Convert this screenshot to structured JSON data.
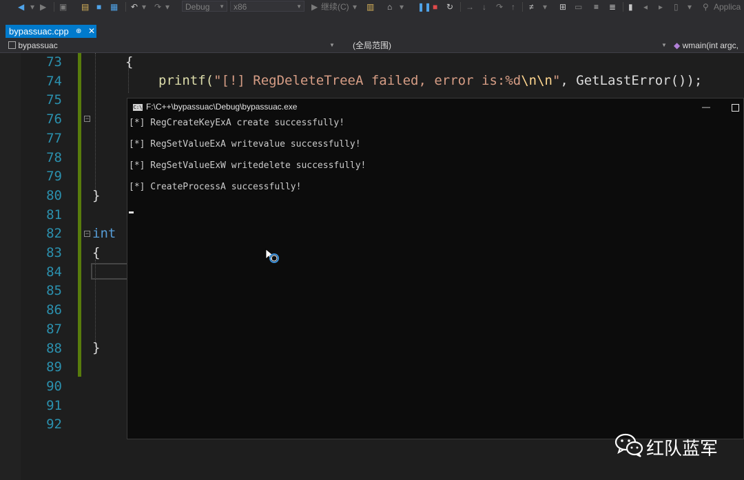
{
  "toolbar": {
    "config": "Debug",
    "platform": "x86",
    "continue_label": "继续(C)",
    "app_label": "Applica"
  },
  "tabs": [
    {
      "label": "bypassuac.cpp"
    }
  ],
  "navbar": {
    "project": "bypassuac",
    "scope": "(全局范围)",
    "member": "wmain(int argc,"
  },
  "editor": {
    "line_numbers": [
      "73",
      "74",
      "75",
      "76",
      "77",
      "78",
      "79",
      "80",
      "81",
      "82",
      "83",
      "84",
      "85",
      "86",
      "87",
      "88",
      "89",
      "90",
      "91",
      "92"
    ],
    "code": {
      "l73": "{",
      "l74_fn": "printf(",
      "l74_str1": "\"[!] RegDeleteTreeA failed, error is:%d",
      "l74_esc": "\\n\\n",
      "l74_str2": "\"",
      "l74_rest": ", GetLastError());",
      "l80": "}",
      "l82_kw": "int",
      "l83": "{",
      "l88": "}"
    }
  },
  "console": {
    "title": "F:\\C++\\bypassuac\\Debug\\bypassuac.exe",
    "icon_text": "C:\\",
    "lines": [
      "[*] RegCreateKeyExA create successfully!",
      "[*] RegSetValueExA writevalue successfully!",
      "[*] RegSetValueExW writedelete successfully!",
      "[*] CreateProcessA successfully!"
    ]
  },
  "watermark": {
    "text": "红队蓝军"
  },
  "colors": {
    "accent": "#007acc",
    "line_numbers": "#2b91af",
    "keyword": "#569cd6",
    "string": "#d69d85",
    "change_bar": "#587c0c"
  }
}
